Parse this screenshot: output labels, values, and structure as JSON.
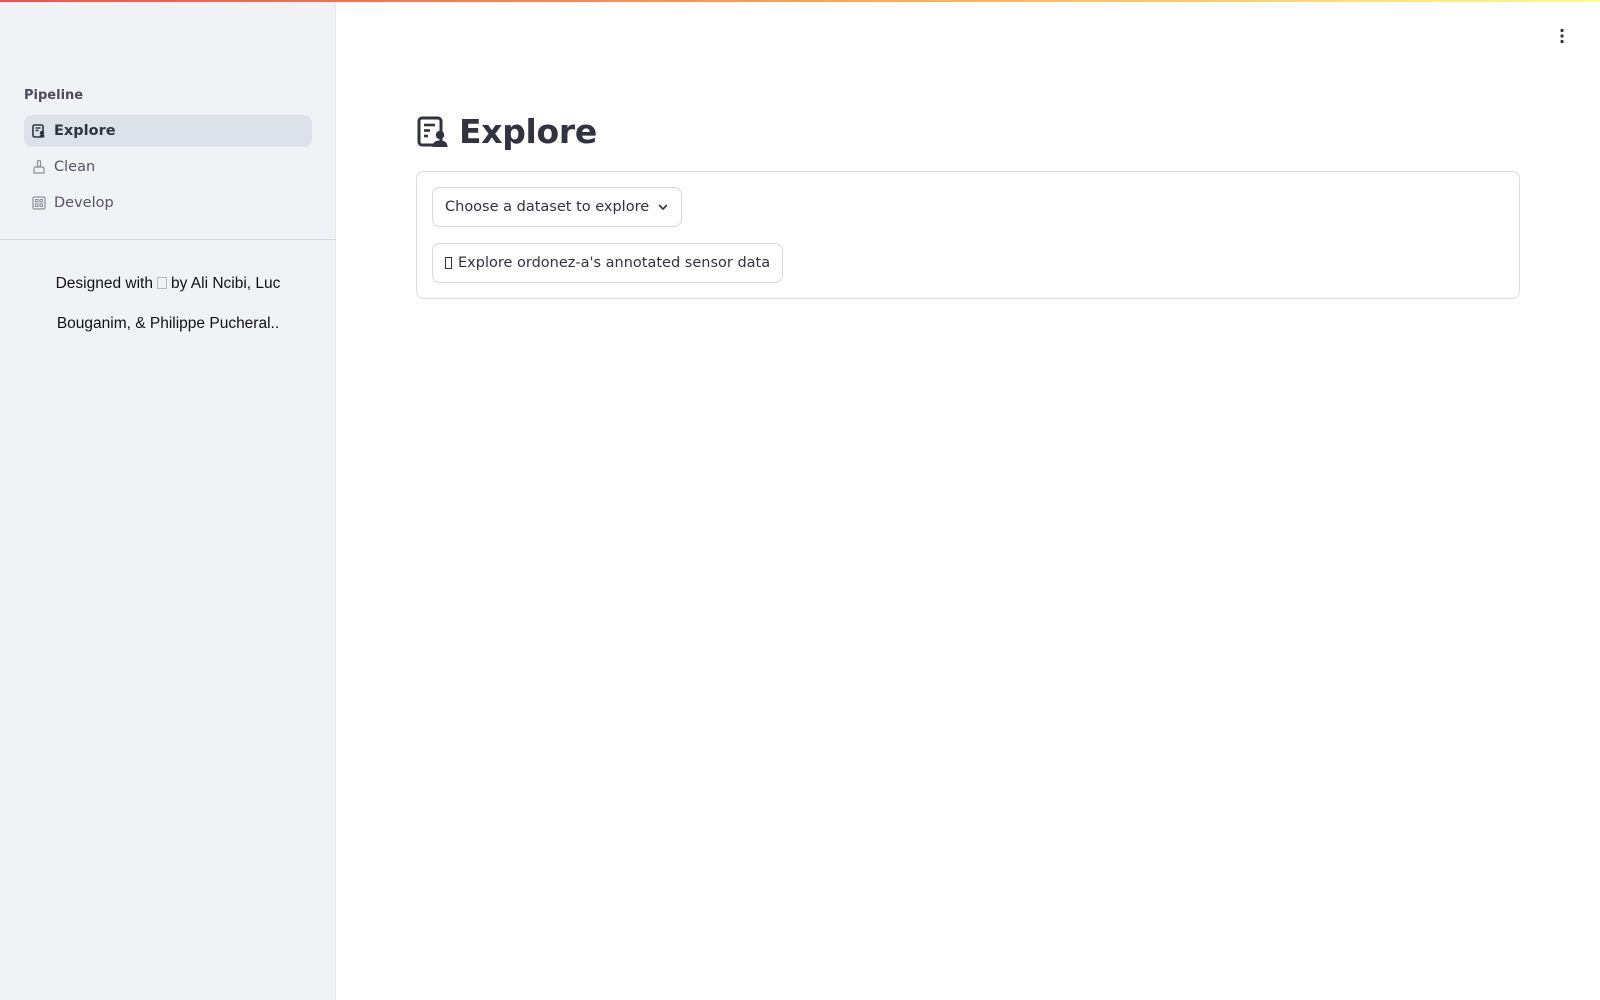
{
  "sidebar": {
    "section_label": "Pipeline",
    "items": [
      {
        "label": "Explore",
        "icon": "explore-report-icon",
        "active": true
      },
      {
        "label": "Clean",
        "icon": "cleaning-brush-icon",
        "active": false
      },
      {
        "label": "Develop",
        "icon": "develop-dashboard-icon",
        "active": false
      }
    ],
    "credits": {
      "prefix": "Designed with",
      "suffix": "by Ali Ncibi, Luc Bouganim, & Philippe Pucheral.."
    }
  },
  "header": {
    "menu_icon": "vertical-ellipsis-icon"
  },
  "main": {
    "title": "Explore",
    "title_icon": "explore-report-icon",
    "dataset_select": {
      "placeholder": "Choose a dataset to explore"
    },
    "explore_button": {
      "label": "Explore ordonez-a's annotated sensor data"
    }
  },
  "colors": {
    "sidebar_bg": "#f0f2f6",
    "active_item_bg": "#dde1e9",
    "text": "#31333f",
    "gradient_start": "#ff4b4b",
    "gradient_end": "#fffd80"
  }
}
